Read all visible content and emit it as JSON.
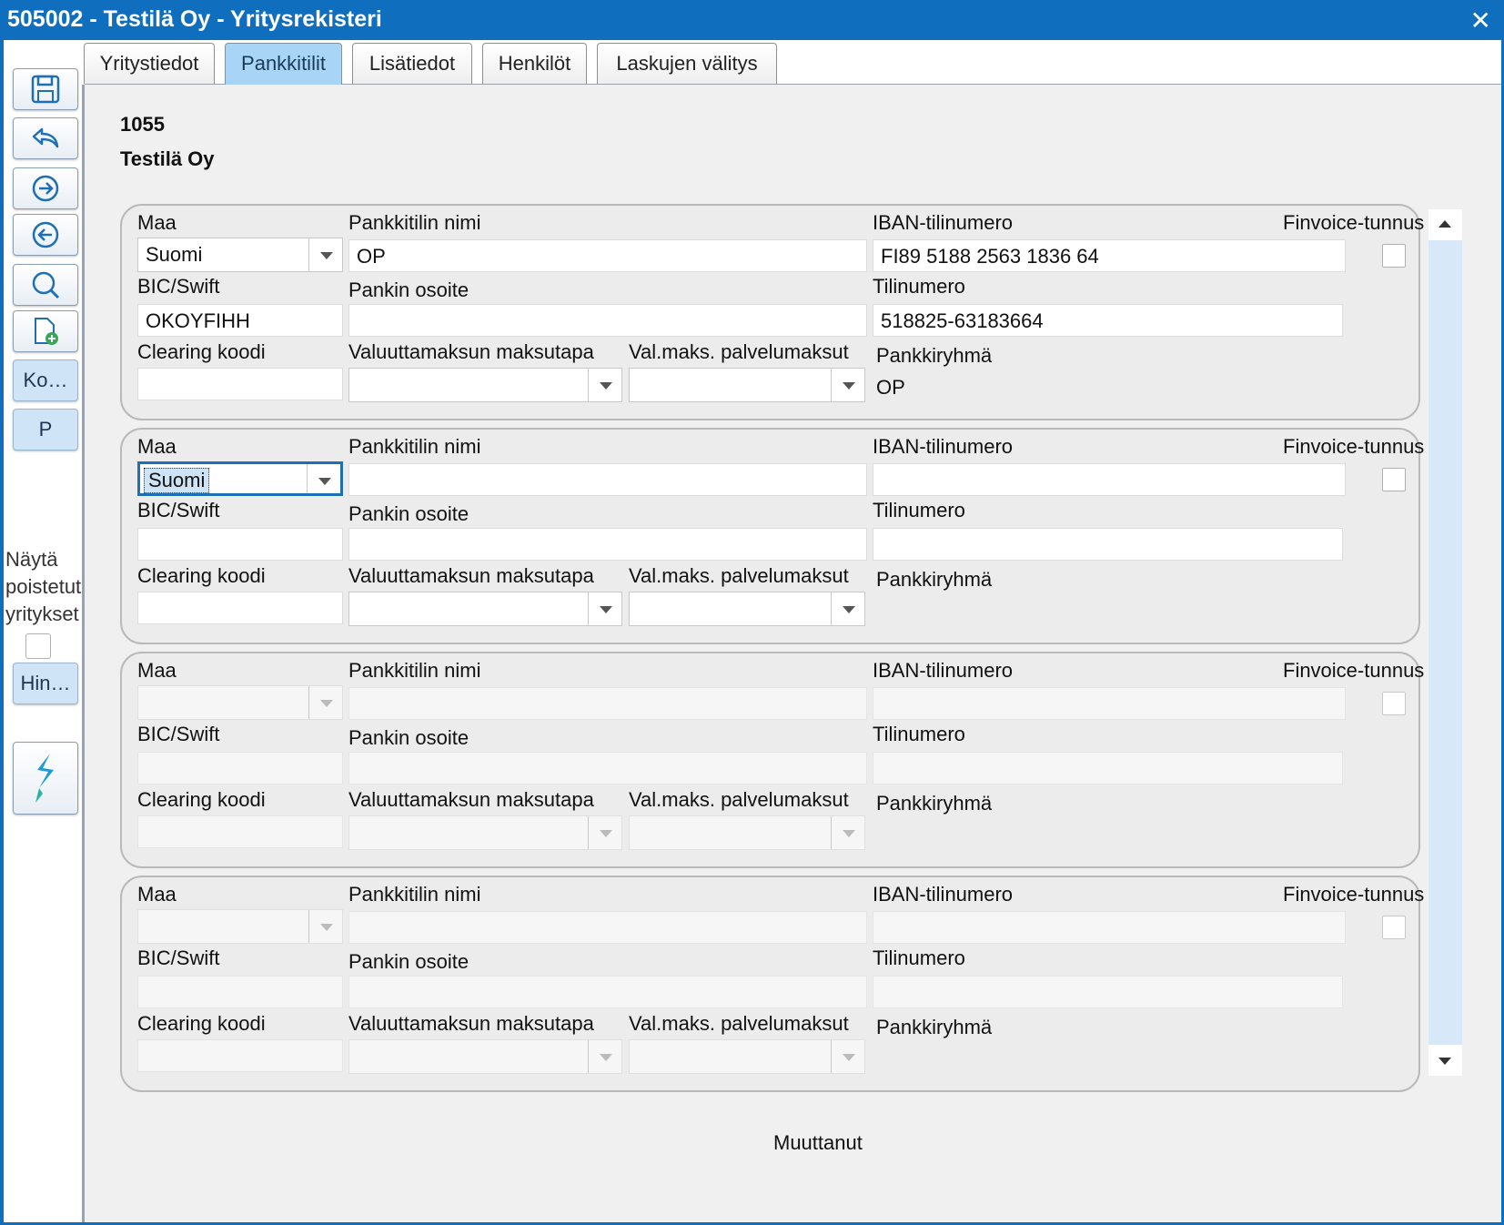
{
  "window": {
    "title": "505002 - Testilä Oy - Yritysrekisteri",
    "close_icon": "close-icon"
  },
  "toolbar": {
    "buttons": [
      "save-icon",
      "undo-icon",
      "next-icon",
      "previous-icon",
      "search-icon",
      "new-document-icon"
    ],
    "ko_label": "Ko…",
    "p_label": "P",
    "show_deleted_label": "Näytä poistetut yritykset",
    "hin_label": "Hin…"
  },
  "tabs": [
    "Yritystiedot",
    "Pankkitilit",
    "Lisätiedot",
    "Henkilöt",
    "Laskujen välitys"
  ],
  "active_tab": "Pankkitilit",
  "company": {
    "number": "1055",
    "name": "Testilä Oy"
  },
  "labels": {
    "country": "Maa",
    "account_name": "Pankkitilin nimi",
    "iban": "IBAN-tilinumero",
    "finvoice": "Finvoice-tunnus",
    "bic": "BIC/Swift",
    "bank_address": "Pankin osoite",
    "account_number": "Tilinumero",
    "clearing": "Clearing koodi",
    "fx_payment_method": "Valuuttamaksun maksutapa",
    "fx_service_fees": "Val.maks. palvelumaksut",
    "bank_group": "Pankkiryhmä"
  },
  "accounts": [
    {
      "country": "Suomi",
      "account_name": "OP",
      "iban": "FI89 5188 2563 1836 64",
      "bic": "OKOYFIHH",
      "bank_address": "",
      "account_number": "518825-63183664",
      "clearing": "",
      "fx_payment_method": "",
      "fx_service_fees": "",
      "bank_group": "OP",
      "finvoice": false
    },
    {
      "country": "Suomi",
      "account_name": "",
      "iban": "",
      "bic": "",
      "bank_address": "",
      "account_number": "",
      "clearing": "",
      "fx_payment_method": "",
      "fx_service_fees": "",
      "bank_group": "",
      "finvoice": false
    },
    {
      "country": "",
      "account_name": "",
      "iban": "",
      "bic": "",
      "bank_address": "",
      "account_number": "",
      "clearing": "",
      "fx_payment_method": "",
      "fx_service_fees": "",
      "bank_group": "",
      "finvoice": false
    },
    {
      "country": "",
      "account_name": "",
      "iban": "",
      "bic": "",
      "bank_address": "",
      "account_number": "",
      "clearing": "",
      "fx_payment_method": "",
      "fx_service_fees": "",
      "bank_group": "",
      "finvoice": false
    }
  ],
  "footer": {
    "changed_by_label": "Muuttanut"
  },
  "colors": {
    "titlebar": "#106ebe",
    "active_tab": "#a8d5f5",
    "focus": "#1f6fb5"
  }
}
